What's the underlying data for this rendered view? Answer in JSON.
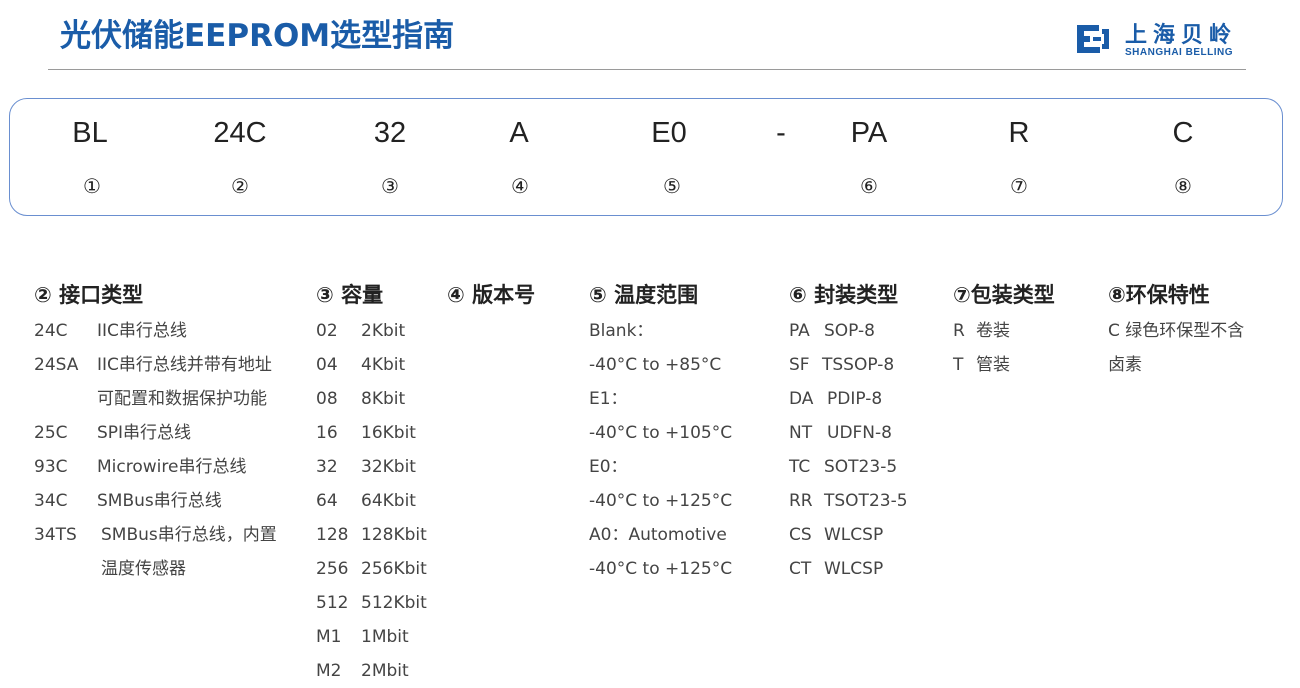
{
  "header": {
    "title": "光伏储能EEPROM选型指南",
    "logo_cn": "上海贝岭",
    "logo_en": "SHANGHAI BELLING",
    "brand_color": "#1a5ca8"
  },
  "code": {
    "segments": [
      "BL",
      "24C",
      "32",
      "A",
      "E0",
      "-",
      "PA",
      "R",
      "C"
    ],
    "numbers": [
      "①",
      "②",
      "③",
      "④",
      "⑤",
      "",
      "⑥",
      "⑦",
      "⑧"
    ]
  },
  "interface": {
    "heading": "② 接口类型",
    "rows": [
      {
        "code": "24C",
        "desc": "IIC串行总线"
      },
      {
        "code": "24SA",
        "desc": "IIC串行总线并带有地址"
      },
      {
        "code": "",
        "desc": "可配置和数据保护功能"
      },
      {
        "code": "25C",
        "desc": "SPI串行总线"
      },
      {
        "code": "93C",
        "desc": "Microwire串行总线"
      },
      {
        "code": "34C",
        "desc": "SMBus串行总线"
      },
      {
        "code": "34TS",
        "desc": "SMBus串行总线，内置"
      },
      {
        "code": "",
        "desc": "温度传感器"
      }
    ]
  },
  "capacity": {
    "heading": "③ 容量",
    "rows": [
      {
        "code": "02",
        "desc": "2Kbit"
      },
      {
        "code": "04",
        "desc": "4Kbit"
      },
      {
        "code": "08",
        "desc": "8Kbit"
      },
      {
        "code": "16",
        "desc": "16Kbit"
      },
      {
        "code": "32",
        "desc": "32Kbit"
      },
      {
        "code": "64",
        "desc": "64Kbit"
      },
      {
        "code": "128",
        "desc": "128Kbit"
      },
      {
        "code": "256",
        "desc": "256Kbit"
      },
      {
        "code": "512",
        "desc": "512Kbit"
      },
      {
        "code": "M1",
        "desc": "1Mbit"
      },
      {
        "code": "M2",
        "desc": "2Mbit"
      }
    ]
  },
  "version": {
    "heading": "④ 版本号"
  },
  "temperature": {
    "heading": "⑤ 温度范围",
    "lines": [
      "Blank：",
      "-40°C to +85°C",
      "E1：",
      "-40°C to +105°C",
      "E0：",
      "-40°C to +125°C",
      "A0：Automotive",
      "-40°C to +125°C"
    ]
  },
  "package": {
    "heading": "⑥ 封装类型",
    "rows": [
      {
        "code": "PA",
        "desc": "SOP-8"
      },
      {
        "code": "SF",
        "desc": "TSSOP-8"
      },
      {
        "code": "DA",
        "desc": "PDIP-8"
      },
      {
        "code": "NT",
        "desc": "UDFN-8"
      },
      {
        "code": "TC",
        "desc": "SOT23-5"
      },
      {
        "code": "RR",
        "desc": "TSOT23-5"
      },
      {
        "code": "CS",
        "desc": "WLCSP"
      },
      {
        "code": "CT",
        "desc": "WLCSP"
      }
    ]
  },
  "packing": {
    "heading": "⑦包装类型",
    "rows": [
      {
        "code": "R",
        "desc": "卷装"
      },
      {
        "code": "T",
        "desc": "管装"
      }
    ]
  },
  "eco": {
    "heading": "⑧环保特性",
    "lines": [
      "C  绿色环保型不含",
      "卤素"
    ]
  }
}
